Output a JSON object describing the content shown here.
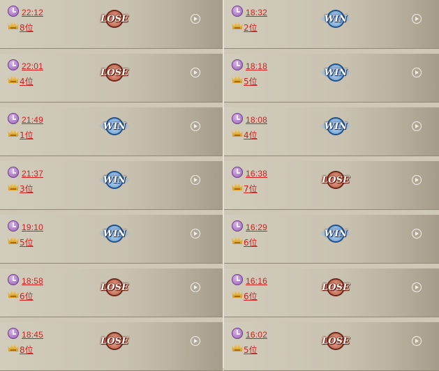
{
  "colors": {
    "link_red": "#cc1f1f",
    "panel": "#c9c2b1"
  },
  "icons": {
    "time": "clock-icon",
    "rank": "crown-icon",
    "replay": "play-icon"
  },
  "left": [
    {
      "time": "22:12",
      "rank": "8位",
      "result": "LOSE"
    },
    {
      "time": "22:01",
      "rank": "4位",
      "result": "LOSE"
    },
    {
      "time": "21:49",
      "rank": "1位",
      "result": "WIN"
    },
    {
      "time": "21:37",
      "rank": "3位",
      "result": "WIN"
    },
    {
      "time": "19:10",
      "rank": "5位",
      "result": "WIN"
    },
    {
      "time": "18:58",
      "rank": "6位",
      "result": "LOSE"
    },
    {
      "time": "18:45",
      "rank": "8位",
      "result": "LOSE"
    }
  ],
  "right": [
    {
      "time": "18:32",
      "rank": "2位",
      "result": "WIN"
    },
    {
      "time": "18:18",
      "rank": "5位",
      "result": "WIN"
    },
    {
      "time": "18:08",
      "rank": "4位",
      "result": "WIN"
    },
    {
      "time": "16:38",
      "rank": "7位",
      "result": "LOSE"
    },
    {
      "time": "16:29",
      "rank": "6位",
      "result": "WIN"
    },
    {
      "time": "16:16",
      "rank": "6位",
      "result": "LOSE"
    },
    {
      "time": "16:02",
      "rank": "5位",
      "result": "LOSE"
    }
  ]
}
